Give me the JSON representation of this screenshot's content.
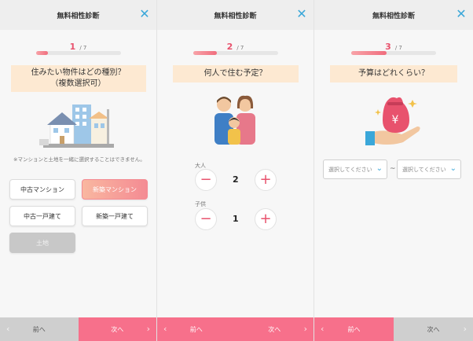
{
  "screens": [
    {
      "title": "無料相性診断",
      "step": "1",
      "total": "/ 7",
      "progress": 0.14,
      "question_line1": "住みたい物件はどの種別？",
      "question_line2": "（複数選択可）",
      "note": "※マンションと土地を一緒に選択することはできません。",
      "options": [
        "中古マンション",
        "新築マンション",
        "中古一戸建て",
        "新築一戸建て",
        "土地"
      ],
      "prev_label": "前へ",
      "next_label": "次へ"
    },
    {
      "title": "無料相性診断",
      "step": "2",
      "total": "/ 7",
      "progress": 0.28,
      "question": "何人で住む予定？",
      "adults_label": "大人",
      "adults_value": "2",
      "children_label": "子供",
      "children_value": "1",
      "minus": "−",
      "plus": "+",
      "prev_label": "前へ",
      "next_label": "次へ"
    },
    {
      "title": "無料相性診断",
      "step": "3",
      "total": "/ 7",
      "progress": 0.42,
      "question": "予算はどれくらい？",
      "select_min_placeholder": "選択してください",
      "select_max_placeholder": "選択してください",
      "range_separator": "~",
      "prev_label": "前へ",
      "next_label": "次へ"
    }
  ],
  "icons": {
    "close": "close-icon",
    "chevron_left": "chevron-left-icon",
    "chevron_right": "chevron-right-icon",
    "chevron_down": "chevron-down-icon"
  },
  "colors": {
    "accent": "#e8526d",
    "pink_button": "#f7708b",
    "question_bg": "#fde9d2",
    "link_blue": "#3aa7d9"
  }
}
